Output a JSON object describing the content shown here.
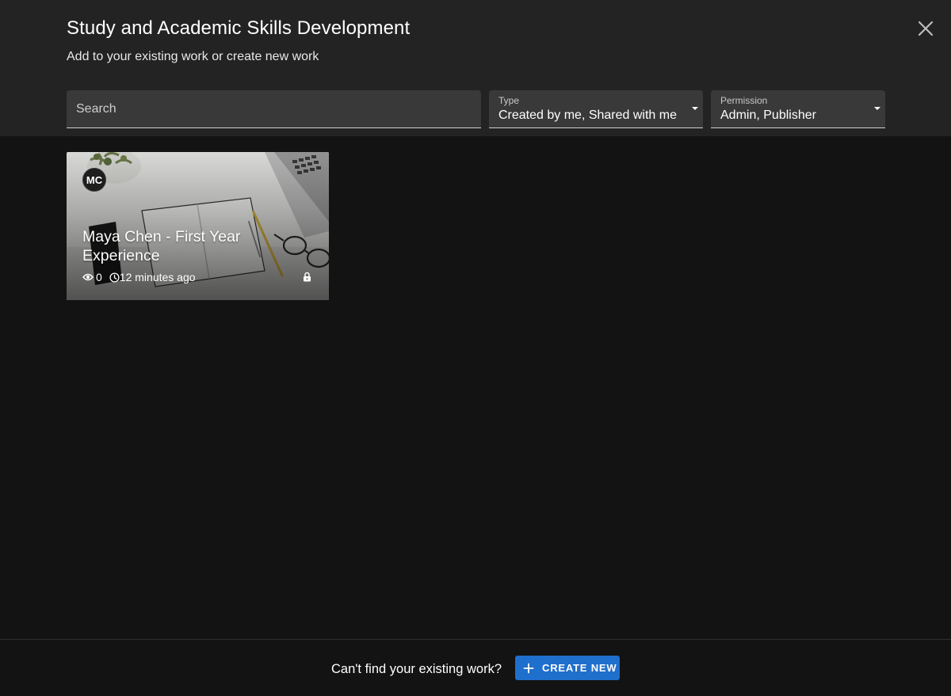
{
  "dialog": {
    "title": "Study and Academic Skills Development",
    "subtitle": "Add to your existing work or create new work",
    "close_icon": "close-icon"
  },
  "filters": {
    "search": {
      "placeholder": "Search",
      "value": ""
    },
    "type": {
      "label": "Type",
      "value": "Created by me, Shared with me"
    },
    "permission": {
      "label": "Permission",
      "value": "Admin, Publisher"
    }
  },
  "cards": [
    {
      "avatar_initials": "MC",
      "title": "Maya Chen - First Year Experience",
      "views": "0",
      "updated": "12 minutes ago",
      "icons": [
        "eye-icon",
        "clock-icon",
        "lock-icon"
      ]
    }
  ],
  "footer": {
    "prompt": "Can't find your existing work?",
    "create_label": "CREATE NEW",
    "create_icon": "plus-icon"
  },
  "colors": {
    "header_bg": "#232323",
    "body_bg": "#131313",
    "field_bg": "#393939",
    "accent": "#1f6fcc"
  }
}
